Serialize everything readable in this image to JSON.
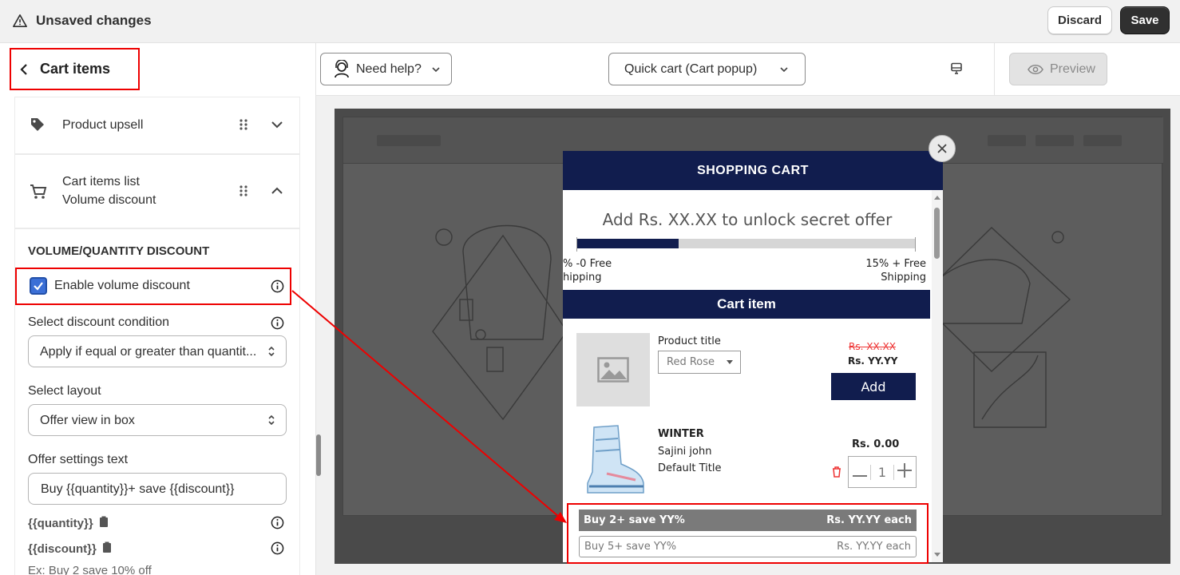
{
  "topbar": {
    "title": "Unsaved changes",
    "discard_label": "Discard",
    "save_label": "Save"
  },
  "sidebar": {
    "back_label": "Cart items",
    "items": [
      {
        "label": "Product upsell"
      },
      {
        "label": "Cart items list",
        "sublabel": "Volume discount"
      }
    ],
    "section_title": "VOLUME/QUANTITY DISCOUNT",
    "enable_label": "Enable volume discount",
    "condition_label": "Select discount condition",
    "condition_value": "Apply if equal or greater than quantit...",
    "layout_label": "Select layout",
    "layout_value": "Offer view in box",
    "offer_label": "Offer settings text",
    "offer_value": "Buy {{quantity}}+ save {{discount}}",
    "var_quantity": "{{quantity}}",
    "var_discount": "{{discount}}",
    "example": "Ex: Buy 2 save 10% off"
  },
  "toolbar": {
    "help_label": "Need help?",
    "cart_type": "Quick cart (Cart popup)",
    "preview_label": "Preview"
  },
  "popup": {
    "header": "SHOPPING CART",
    "offer_text": "Add Rs. XX.XX to unlock secret offer",
    "progress": 0.3,
    "milestone_left_1": "% -0 Free",
    "milestone_left_2": "hipping",
    "milestone_right_1": "15% + Free",
    "milestone_right_2": "Shipping",
    "cart_item_label": "Cart item",
    "upsell": {
      "title": "Product title",
      "variant": "Red Rose",
      "compare_price": "Rs. XX.XX",
      "price": "Rs. YY.YY",
      "add_label": "Add"
    },
    "item": {
      "name": "WINTER",
      "vendor": "Sajini john",
      "variant": "Default Title",
      "price": "Rs. 0.00",
      "qty": "1"
    },
    "tiers": [
      {
        "label": "Buy 2+ save YY%",
        "price": "Rs. YY.YY each"
      },
      {
        "label": "Buy 5+ save YY%",
        "price": "Rs. YY.YY each"
      }
    ]
  },
  "colors": {
    "accent": "#111d4e",
    "highlight": "#ee0000",
    "checkbox": "#3b6fd6"
  }
}
